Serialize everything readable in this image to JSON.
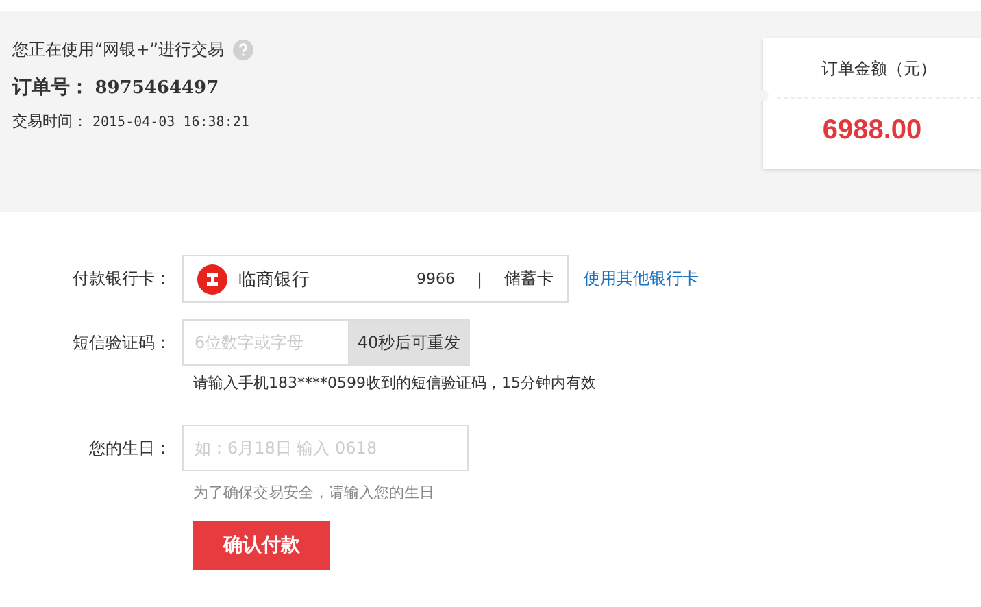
{
  "header": {
    "notice": "您正在使用“网银+”进行交易",
    "order_label": "订单号：",
    "order_number": "8975464497",
    "time_label": "交易时间：",
    "time_value": "2015-04-03 16:38:21"
  },
  "amount_card": {
    "label": "订单金额（元）",
    "amount": "6988.00"
  },
  "form": {
    "bank": {
      "label": "付款银行卡：",
      "bank_name": "临商银行",
      "card_tail": "9966",
      "separator": "|",
      "card_type": "储蓄卡",
      "link": "使用其他银行卡"
    },
    "sms": {
      "label": "短信验证码：",
      "placeholder": "6位数字或字母",
      "resend_button": "40秒后可重发",
      "disabled": true,
      "hint": "请输入手机183****0599收到的短信验证码，15分钟内有效"
    },
    "birthday": {
      "label": "您的生日：",
      "placeholder": "如：6月18日 输入 0618",
      "hint": "为了确保交易安全，请输入您的生日"
    },
    "submit": "确认付款"
  }
}
